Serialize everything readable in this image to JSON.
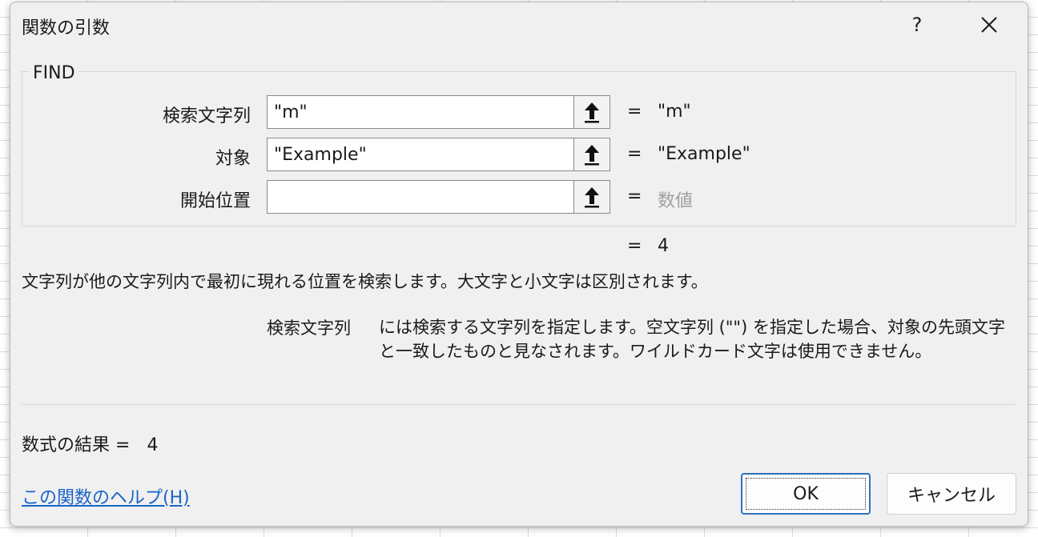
{
  "dialog": {
    "title": "関数の引数",
    "help_button": "?",
    "close_icon": "close-x-icon"
  },
  "function": {
    "name": "FIND",
    "arguments": [
      {
        "label": "検索文字列",
        "value": "\"m\"",
        "evaluated": "\"m\"",
        "button_icon": "collapse-arrow-icon"
      },
      {
        "label": "対象",
        "value": "\"Example\"",
        "evaluated": "\"Example\"",
        "button_icon": "collapse-arrow-icon"
      },
      {
        "label": "開始位置",
        "value": "",
        "evaluated": "数値",
        "button_icon": "collapse-arrow-icon"
      }
    ],
    "equals_sign": "=",
    "result": "4"
  },
  "description": "文字列が他の文字列内で最初に現れる位置を検索します。大文字と小文字は区別されます。",
  "argument_help": {
    "name": "検索文字列",
    "text": "には検索する文字列を指定します。空文字列 (\"\") を指定した場合、対象の先頭文字と一致したものと見なされます。ワイルドカード文字は使用できません。"
  },
  "formula_result": {
    "label": "数式の結果 =",
    "value": "4"
  },
  "help_link": "この関数のヘルプ(H)",
  "buttons": {
    "ok": "OK",
    "cancel": "キャンセル"
  },
  "colors": {
    "dialog_bg": "#f0f0f0",
    "link": "#1a64c8",
    "ok_border": "#2f6fbf",
    "placeholder": "#a0a0a0"
  }
}
